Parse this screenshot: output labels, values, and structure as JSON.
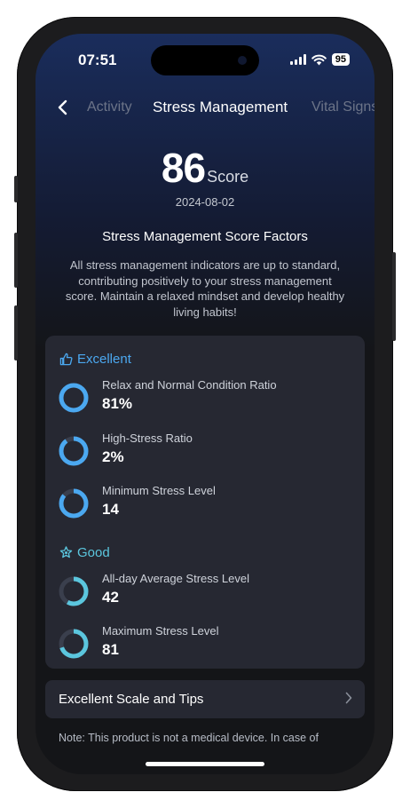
{
  "status_bar": {
    "time": "07:51",
    "battery": "95"
  },
  "nav": {
    "tabs": [
      {
        "label": "Activity"
      },
      {
        "label": "Stress Management"
      },
      {
        "label": "Vital Signs"
      }
    ],
    "active_tab": "Stress Management"
  },
  "score": {
    "value": "86",
    "unit": "Score",
    "date": "2024-08-02"
  },
  "factors": {
    "title": "Stress Management Score Factors",
    "description": "All stress management indicators are up to standard, contributing positively to your stress management score. Maintain a relaxed mindset and develop healthy living habits!"
  },
  "groups": [
    {
      "label": "Excellent",
      "color": "#4ba8f0",
      "icon": "thumbs-up-icon",
      "items": [
        {
          "label": "Relax and Normal Condition Ratio",
          "value": "81%",
          "ring_fill": 1.0
        },
        {
          "label": "High-Stress Ratio",
          "value": "2%",
          "ring_fill": 0.9
        },
        {
          "label": "Minimum Stress Level",
          "value": "14",
          "ring_fill": 0.86
        }
      ]
    },
    {
      "label": "Good",
      "color": "#5bc6de",
      "icon": "star-badge-icon",
      "items": [
        {
          "label": "All-day Average Stress Level",
          "value": "42",
          "ring_fill": 0.58
        },
        {
          "label": "Maximum Stress Level",
          "value": "81",
          "ring_fill": 0.7
        }
      ]
    }
  ],
  "tips": {
    "label": "Excellent Scale and Tips"
  },
  "note": "Note: This product is not a medical device. In case of"
}
